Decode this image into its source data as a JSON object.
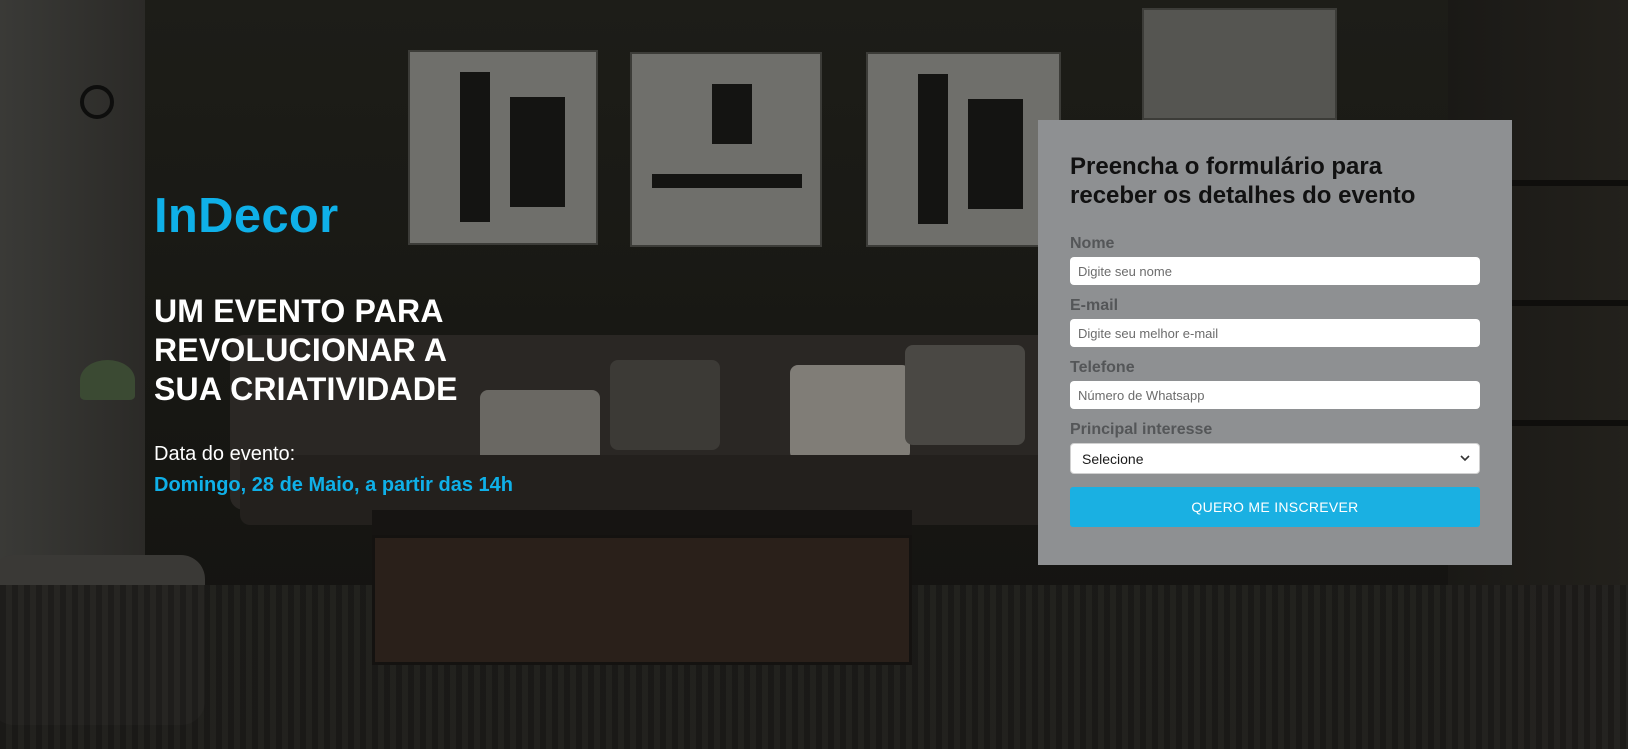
{
  "hero": {
    "brand": "InDecor",
    "headline": "UM EVENTO PARA\nREVOLUCIONAR A\nSUA CRIATIVIDADE",
    "date_label": "Data do evento:",
    "date_value": "Domingo, 28 de Maio, a partir das 14h"
  },
  "form": {
    "title": "Preencha o formulário para\nreceber os detalhes do evento",
    "fields": [
      {
        "label": "Nome",
        "placeholder": "Digite seu nome"
      },
      {
        "label": "E-mail",
        "placeholder": "Digite seu melhor e-mail"
      },
      {
        "label": "Telefone",
        "placeholder": "Número de Whatsapp"
      }
    ],
    "interest": {
      "label": "Principal interesse",
      "selected": "Selecione"
    },
    "submit_label": "QUERO ME INSCREVER"
  },
  "colors": {
    "accent": "#0fb0e8",
    "button": "#1ab0e2",
    "card_bg": "#8e9092",
    "label": "#545658"
  },
  "icons": {
    "select_arrow": "chevron-down-icon"
  }
}
